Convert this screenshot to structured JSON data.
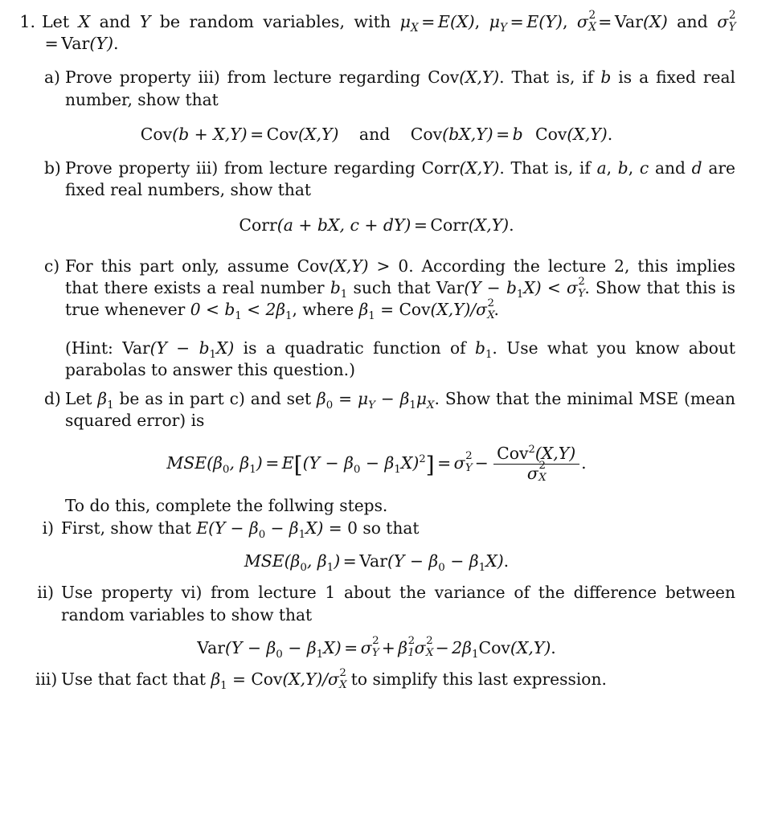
{
  "document": {
    "type": "math-problem-set",
    "background_color": "#ffffff",
    "text_color": "#121212"
  },
  "problem": {
    "marker": "1.",
    "stem_line1_a": "Let ",
    "stem_X": "X",
    "stem_line1_b": " and ",
    "stem_Y": "Y",
    "stem_line1_c": " be random variables, with ",
    "mu_X": "μ",
    "sub_X": "X",
    "eq": "=",
    "E": "E",
    "paren_X": "(X)",
    "comma": ", ",
    "mu_Y": "μ",
    "sub_Y": "Y",
    "paren_Y": "(Y)",
    "sigma": "σ",
    "two": "2",
    "Var": "Var",
    "and_word": " and ",
    "period": "."
  },
  "parts": {
    "a": {
      "marker": "a)",
      "text_1": "Prove property iii) from lecture regarding ",
      "cov": "Cov",
      "cov_args": "(X,Y)",
      "text_2": ". That is, if ",
      "var_b": "b",
      "text_3": " is a fixed real number, show that",
      "equation": {
        "lhs_fn": "Cov",
        "lhs_args_b_plus": "(b + X,Y)",
        "equals": "=",
        "rhs_fn": "Cov",
        "rhs_args": "(X,Y)",
        "conjunction": "and",
        "lhs2_args": "(bX,Y)",
        "coef_b": "b",
        "terminal": "."
      }
    },
    "b": {
      "marker": "b)",
      "text_1": "Prove property iii) from lecture regarding ",
      "corr": "Corr",
      "corr_args": "(X,Y)",
      "text_2": ". That is, if ",
      "var_a": "a",
      "sep1": ", ",
      "var_b": "b",
      "sep2": ", ",
      "var_c": "c",
      "sep3": " and ",
      "var_d": "d",
      "text_3": " are fixed real numbers, show that",
      "equation": {
        "fn": "Corr",
        "args": "(a + bX, c + dY)",
        "equals": "=",
        "rhs_fn": "Corr",
        "rhs_args": "(X,Y)",
        "terminal": "."
      }
    },
    "c": {
      "marker": "c)",
      "text_1": "For this part only, assume ",
      "cov": "Cov",
      "cov_args": "(X,Y)",
      "gt_zero": " > 0",
      "text_2": ". According the lecture 2, this implies that there exists a real number ",
      "b_sub": "b",
      "b_idx": "1",
      "text_3": " such that ",
      "Var": "Var",
      "var_args": "(Y − b",
      "var_args_2": "X)",
      "lt": " < ",
      "sigma": "σ",
      "text_4": ". Show that this is true whenever ",
      "ineq": "0 < b",
      "ineq_2": " < 2β",
      "text_5": ", where ",
      "beta": "β",
      "beta_idx": "1",
      "eq": " = ",
      "cov2": "Cov",
      "cov2_args": "(X,Y)/",
      "terminal": ".",
      "hint": {
        "open": "(Hint: ",
        "Var": "Var",
        "args": "(Y − b",
        "args_2": "X)",
        "text": " is a quadratic function of ",
        "b": "b",
        "b_idx": "1",
        "text_2": ". Use what you know about parabolas to answer this question.)"
      }
    },
    "d": {
      "marker": "d)",
      "text_1": "Let ",
      "beta": "β",
      "beta_idx_1": "1",
      "text_2": " be as in part c) and set ",
      "beta_0": "β",
      "beta_idx_0": "0",
      "eq": " = ",
      "mu_Y": "μ",
      "sub_Y": "Y",
      "minus": " − ",
      "mu_X": "μ",
      "sub_X": "X",
      "text_3": ". Show that the minimal MSE (mean squared error) is",
      "equation": {
        "MSE": "MSE",
        "args": "(β",
        "idx0": "0",
        "comma": ", β",
        "idx1": "1",
        "close": ")",
        "equals": "=",
        "E": "E",
        "bracket_open": "[",
        "inner": "(Y − β",
        "inner_2": " − β",
        "inner_3": "X)",
        "sq": "2",
        "bracket_close": "]",
        "equals2": "=",
        "sigma": "σ",
        "minus": "−",
        "num_fn": "Cov",
        "num_pow": "2",
        "num_args": "(X,Y)",
        "den_sigma": "σ",
        "terminal": "."
      },
      "lead_in": "To do this, complete the follwing steps.",
      "sub": {
        "i": {
          "marker": "i)",
          "text_1": "First, show that ",
          "E": "E",
          "args": "(Y − β",
          "args_2": " − β",
          "args_3": "X)",
          "eq_zero": " = 0",
          "text_2": " so that",
          "equation": {
            "MSE": "MSE",
            "args": "(β",
            "idx0": "0",
            "comma": ", β",
            "idx1": "1",
            "close": ")",
            "equals": "=",
            "Var": "Var",
            "rhs": "(Y − β",
            "rhs_2": " − β",
            "rhs_3": "X)",
            "terminal": "."
          }
        },
        "ii": {
          "marker": "ii)",
          "text": "Use property vi) from lecture 1 about the variance of the difference between random variables to show that",
          "equation": {
            "Var": "Var",
            "args": "(Y − β",
            "args_2": " − β",
            "args_3": "X)",
            "equals": "=",
            "sigma_Y": "σ",
            "plus": "+",
            "beta": "β",
            "sigma_X": "σ",
            "minus": "−",
            "coef": "2β",
            "coef_idx": "1",
            "Cov": "Cov",
            "cov_args": "(X,Y)",
            "terminal": "."
          }
        },
        "iii": {
          "marker": "iii)",
          "text_1": "Use that fact that ",
          "beta": "β",
          "beta_idx": "1",
          "eq": " = ",
          "Cov": "Cov",
          "cov_args": "(X,Y)/",
          "sigma": "σ",
          "text_2": " to simplify this last expression."
        }
      }
    }
  }
}
